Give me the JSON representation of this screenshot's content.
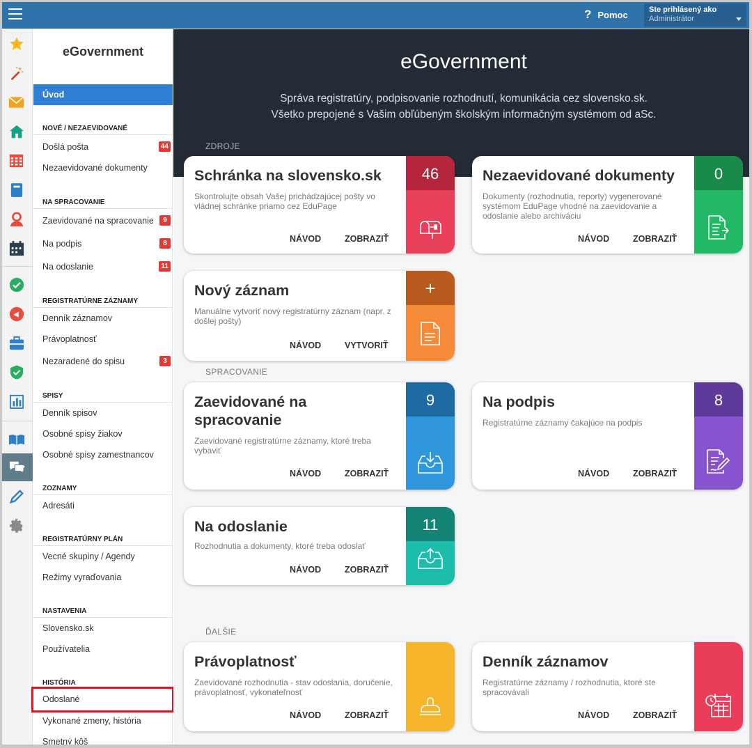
{
  "topbar": {
    "help_icon": "?",
    "help_label": "Pomoc",
    "login_line1": "Ste prihlásený ako",
    "login_line2": "Administrátor"
  },
  "rail": {
    "icons": [
      "star-icon",
      "magic-wand-icon",
      "envelope-icon",
      "home-icon",
      "calendar-grid-icon",
      "book-icon",
      "user-icon",
      "planner-icon",
      "check-circle-icon",
      "megaphone-icon",
      "briefcase-icon",
      "shield-icon",
      "bar-chart-icon",
      "open-book-icon",
      "chat-icon",
      "pen-icon",
      "gear-icon"
    ]
  },
  "sidebar": {
    "title": "eGovernment",
    "intro": "Úvod",
    "sections": {
      "nove": "NOVÉ / NEZAEVIDOVANÉ",
      "spracovanie": "NA SPRACOVANIE",
      "zaznamy": "REGISTRATÚRNE ZÁZNAMY",
      "spisy": "SPISY",
      "zoznamy": "ZOZNAMY",
      "plan": "REGISTRATÚRNY PLÁN",
      "nastavenia": "NASTAVENIA",
      "historia": "HISTÓRIA"
    },
    "items": {
      "dosla_posta": "Došlá pošta",
      "dosla_posta_badge": "44",
      "nezaevidovane": "Nezaevidované dokumenty",
      "zaevidovane": "Zaevidované na spracovanie",
      "zaevidovane_badge": "9",
      "na_podpis": "Na podpis",
      "na_podpis_badge": "8",
      "na_odoslanie": "Na odoslanie",
      "na_odoslanie_badge": "11",
      "dennik_zaznamov": "Denník záznamov",
      "pravoplatnost": "Právoplatnosť",
      "nezaradene": "Nezaradené do spisu",
      "nezaradene_badge": "3",
      "dennik_spisov": "Denník spisov",
      "osobne_ziakov": "Osobné spisy žiakov",
      "osobne_zamestnancov": "Osobné spisy zamestnancov",
      "adresati": "Adresáti",
      "vecne_skupiny": "Vecné skupiny / Agendy",
      "rezimy": "Režimy vyraďovania",
      "slovensko": "Slovensko.sk",
      "pouzivatelia": "Používatelia",
      "odoslane": "Odoslané",
      "vykonane_zmeny": "Vykonané zmeny, história",
      "smetny_kos": "Smetný kôš"
    }
  },
  "hero": {
    "title": "eGovernment",
    "line1": "Správa registratúry, podpisovanie rozhodnutí, komunikácia cez slovensko.sk.",
    "line2": "Všetko prepojené s Vašim obľúbeným školským informačným systémom od aSc."
  },
  "sections": {
    "zdroje": "ZDROJE",
    "spracovanie": "SPRACOVANIE",
    "dalsie": "ĎALŠIE"
  },
  "cards": {
    "schranka": {
      "title": "Schránka na slovensko.sk",
      "desc": "Skontrolujte obsah Vašej prichádzajúcej pošty vo vládnej schránke priamo cez EduPage",
      "count": "46",
      "btn1": "NÁVOD",
      "btn2": "ZOBRAZIŤ",
      "color_top": "#b5253c",
      "color_bottom": "#e8405a"
    },
    "nezaevidovane": {
      "title": "Nezaevidované dokumenty",
      "desc": "Dokumenty (rozhodnutia, reporty) vygenerované systémom EduPage vhodné na zaevidovanie a odoslanie alebo archiváciu",
      "count": "0",
      "btn1": "NÁVOD",
      "btn2": "ZOBRAZIŤ",
      "color_top": "#198a4a",
      "color_bottom": "#23b865"
    },
    "novy": {
      "title": "Nový záznam",
      "desc": "Manuálne vytvoriť nový registratúrny záznam (napr. z došlej pošty)",
      "count": "+",
      "btn1": "NÁVOD",
      "btn2": "VYTVORIŤ",
      "color_top": "#b95a1f",
      "color_bottom": "#f58a38"
    },
    "zaevidovane": {
      "title": "Zaevidované na spracovanie",
      "desc": "Zaevidované registratúrne záznamy, ktoré treba vybaviť",
      "count": "9",
      "btn1": "NÁVOD",
      "btn2": "ZOBRAZIŤ",
      "color_top": "#1e6aa3",
      "color_bottom": "#2f96dc"
    },
    "podpis": {
      "title": "Na podpis",
      "desc": "Registratúrne záznamy čakajúce na podpis",
      "count": "8",
      "btn1": "NÁVOD",
      "btn2": "ZOBRAZIŤ",
      "color_top": "#5e3a9a",
      "color_bottom": "#8753cf"
    },
    "odoslanie": {
      "title": "Na odoslanie",
      "desc": "Rozhodnutia a dokumenty, ktoré treba odoslať",
      "count": "11",
      "btn1": "NÁVOD",
      "btn2": "ZOBRAZIŤ",
      "color_top": "#138476",
      "color_bottom": "#1cbdaa"
    },
    "pravoplatnost": {
      "title": "Právoplatnosť",
      "desc": "Zaevidované rozhodnutia - stav odoslania, doručenie, právoplatnosť, vykonateľnosť",
      "btn1": "NÁVOD",
      "btn2": "ZOBRAZIŤ",
      "color_bottom": "#f7b52c"
    },
    "dennik": {
      "title": "Denník záznamov",
      "desc": "Registratúrne záznamy / rozhodnutia, ktoré ste spracovávali",
      "btn1": "NÁVOD",
      "btn2": "ZOBRAZIŤ",
      "color_bottom": "#ea3d5a"
    }
  }
}
